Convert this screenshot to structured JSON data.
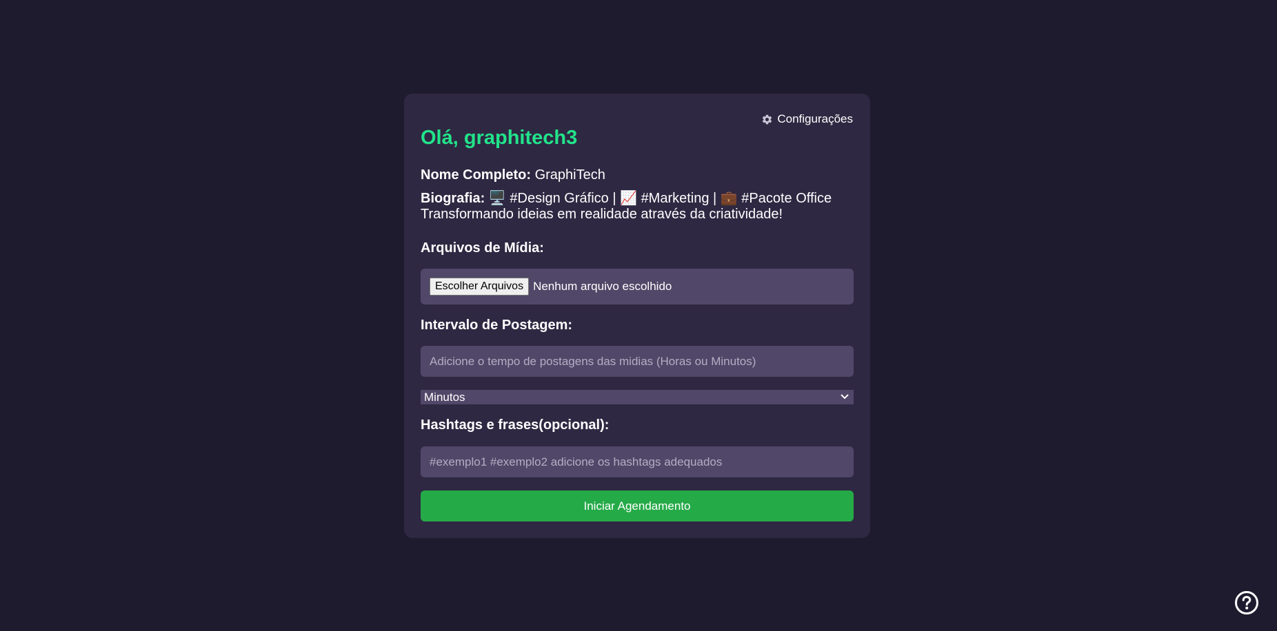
{
  "settings": {
    "icon": "gear-icon",
    "label": "Configurações"
  },
  "greeting": "Olá, graphitech3",
  "profile": {
    "name_label": "Nome Completo:",
    "name_value": "GraphiTech",
    "bio_label": "Biografia:",
    "bio_emoji_1": "🖥️",
    "bio_text_1": "#Design Gráfico |",
    "bio_emoji_2": "📈",
    "bio_text_2": "#Marketing |",
    "bio_emoji_3": "💼",
    "bio_text_3": "#Pacote Office",
    "bio_line_2": "Transformando ideias em realidade através da criatividade!"
  },
  "media": {
    "label": "Arquivos de Mídia:",
    "button_label": "Escolher Arquivos",
    "status": "Nenhum arquivo escolhido"
  },
  "interval": {
    "label": "Intervalo de Postagem:",
    "placeholder": "Adicione o tempo de postagens das midias (Horas ou Minutos)",
    "unit_selected": "Minutos"
  },
  "hashtags": {
    "label": "Hashtags e frases(opcional):",
    "placeholder": "#exemplo1 #exemplo2 adicione os hashtags adequados"
  },
  "submit_label": "Iniciar Agendamento",
  "help": {
    "icon": "help-circle-icon"
  },
  "colors": {
    "background": "#1f1b2e",
    "card": "#2e2842",
    "input": "#514768",
    "accent_green": "#22e38a",
    "button_green": "#25aa48"
  }
}
